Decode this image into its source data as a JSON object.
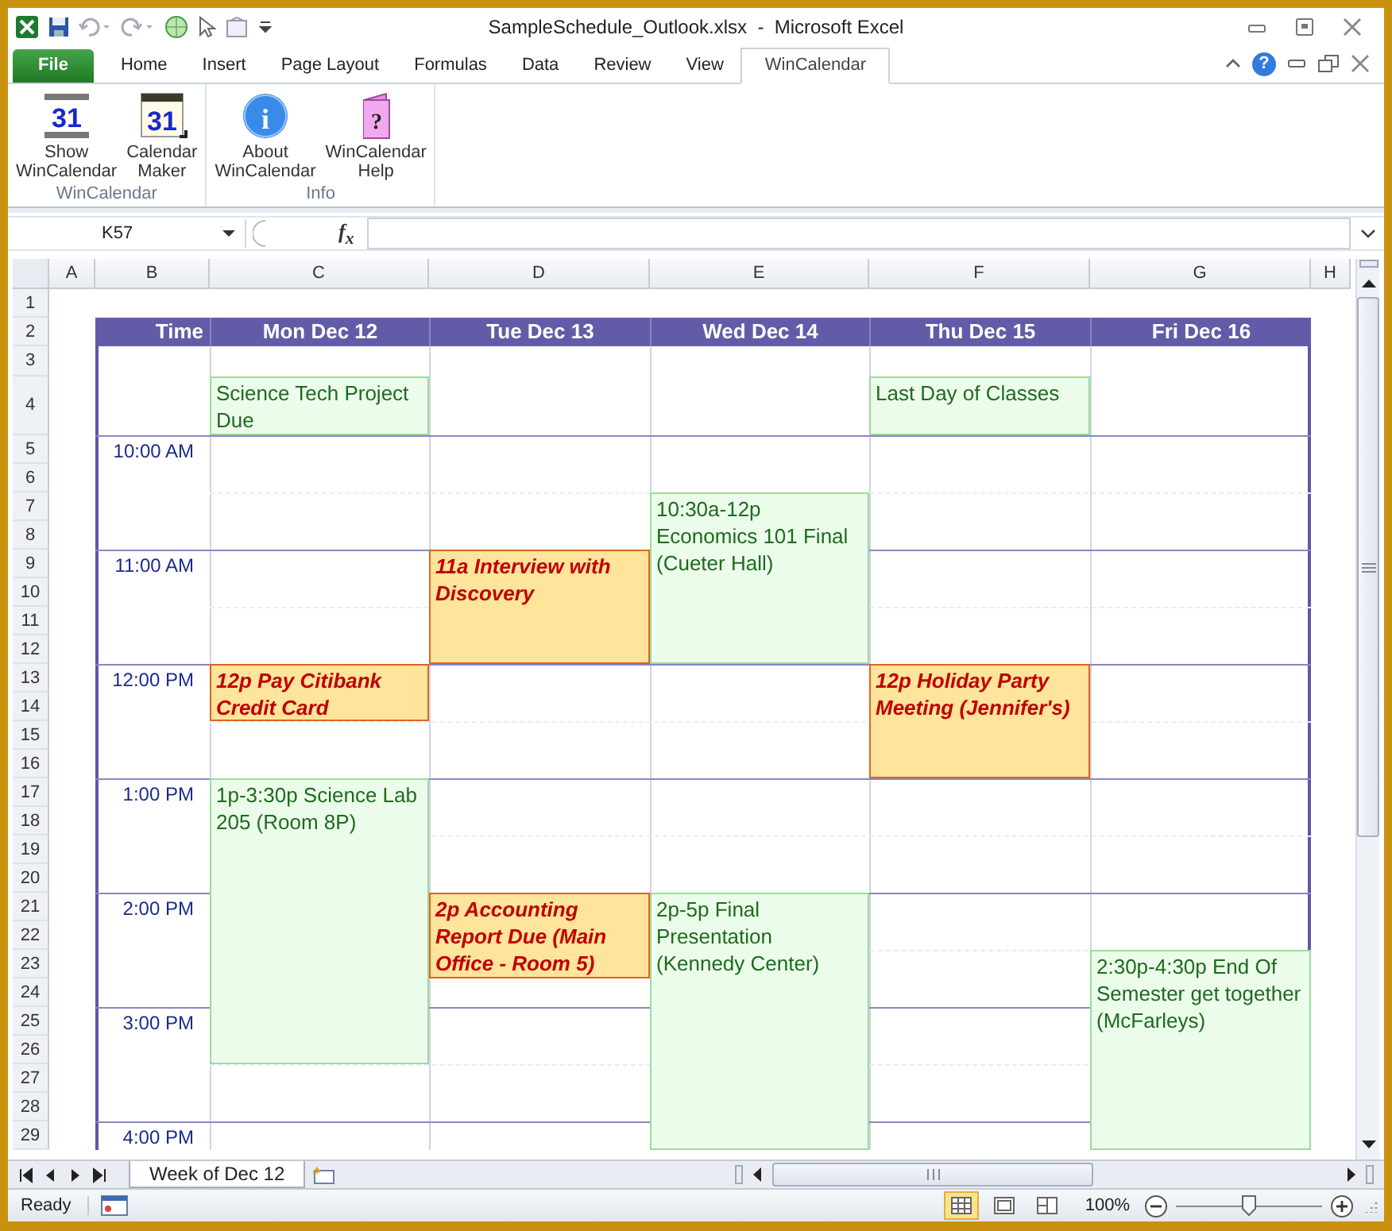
{
  "window": {
    "title": "SampleSchedule_Outlook.xlsx  -  Microsoft Excel"
  },
  "ribbon_tabs": [
    {
      "label": "File",
      "kind": "file",
      "selected": false
    },
    {
      "label": "Home",
      "kind": "tab",
      "selected": false
    },
    {
      "label": "Insert",
      "kind": "tab",
      "selected": false
    },
    {
      "label": "Page Layout",
      "kind": "tab",
      "selected": false
    },
    {
      "label": "Formulas",
      "kind": "tab",
      "selected": false
    },
    {
      "label": "Data",
      "kind": "tab",
      "selected": false
    },
    {
      "label": "Review",
      "kind": "tab",
      "selected": false
    },
    {
      "label": "View",
      "kind": "tab",
      "selected": false
    },
    {
      "label": "WinCalendar",
      "kind": "tab",
      "selected": true
    }
  ],
  "help_glyph": "?",
  "ribbon_groups": [
    {
      "label": "WinCalendar",
      "buttons": [
        {
          "label": "Show WinCalendar",
          "kind": "calendar-arrows",
          "glyph": "31"
        },
        {
          "label": "Calendar Maker",
          "kind": "calendar",
          "glyph": "31"
        }
      ]
    },
    {
      "label": "Info",
      "buttons": [
        {
          "label": "About WinCalendar",
          "kind": "info",
          "glyph": "i"
        },
        {
          "label": "WinCalendar Help",
          "kind": "help-book",
          "glyph": "?"
        }
      ]
    }
  ],
  "formula_bar": {
    "name_box": "K57",
    "function_label": "f$_{x}$"
  },
  "sheet": {
    "columns": [
      "A",
      "B",
      "C",
      "D",
      "E",
      "F",
      "G",
      "H"
    ],
    "rows": [
      {
        "number": "1"
      },
      {
        "number": "2",
        "header": [
          "Time",
          "Mon Dec 12",
          "Tue Dec 13",
          "Wed Dec 14",
          "Thu Dec 15",
          "Fri Dec 16"
        ]
      },
      {
        "number": "3",
        "cells": [
          {
            "kind": "free"
          },
          {
            "kind": "free"
          },
          {
            "kind": "free"
          },
          {
            "kind": "free"
          },
          {
            "kind": "free"
          }
        ]
      },
      {
        "number": "4",
        "cells": [
          {
            "kind": "normal",
            "text": "Science Tech Project Due"
          },
          {
            "kind": "free"
          },
          {
            "kind": "free"
          },
          {
            "kind": "normal",
            "text": "Last Day of Classes"
          },
          {
            "kind": "free"
          }
        ]
      },
      {
        "number": "5",
        "time": "10:00 AM",
        "cells": [
          {
            "kind": "free"
          },
          {
            "kind": "free"
          },
          {
            "kind": "free"
          },
          {
            "kind": "free"
          },
          {
            "kind": "free"
          }
        ]
      },
      {
        "number": "6",
        "cells": [
          {
            "kind": "free"
          },
          {
            "kind": "free"
          },
          {
            "kind": "free"
          },
          {
            "kind": "free"
          },
          {
            "kind": "free"
          }
        ]
      },
      {
        "number": "7",
        "cells": [
          {
            "kind": "free"
          },
          {
            "kind": "free"
          },
          {
            "kind": "normal",
            "text": "10:30a-12p Economics 101 Final (Cueter Hall)"
          },
          {
            "kind": "free"
          },
          {
            "kind": "free"
          }
        ]
      },
      {
        "number": "8",
        "cells": [
          {
            "kind": "free"
          },
          {
            "kind": "free"
          },
          {
            "kind": "continued"
          },
          {
            "kind": "free"
          },
          {
            "kind": "free"
          }
        ]
      },
      {
        "number": "9",
        "time": "11:00 AM",
        "cells": [
          {
            "kind": "free"
          },
          {
            "kind": "important",
            "text": "11a Interview with Discovery"
          },
          {
            "kind": "continued"
          },
          {
            "kind": "free"
          },
          {
            "kind": "free"
          }
        ]
      },
      {
        "number": "10",
        "cells": [
          {
            "kind": "free"
          },
          {
            "kind": "continued"
          },
          {
            "kind": "continued"
          },
          {
            "kind": "free"
          },
          {
            "kind": "free"
          }
        ]
      },
      {
        "number": "11",
        "cells": [
          {
            "kind": "free"
          },
          {
            "kind": "continued"
          },
          {
            "kind": "continued"
          },
          {
            "kind": "free"
          },
          {
            "kind": "free"
          }
        ]
      },
      {
        "number": "12",
        "cells": [
          {
            "kind": "free"
          },
          {
            "kind": "continued"
          },
          {
            "kind": "continued"
          },
          {
            "kind": "free"
          },
          {
            "kind": "free"
          }
        ]
      },
      {
        "number": "13",
        "time": "12:00 PM",
        "cells": [
          {
            "kind": "important",
            "text": "12p Pay Citibank Credit Card"
          },
          {
            "kind": "free"
          },
          {
            "kind": "free"
          },
          {
            "kind": "important",
            "text": "12p Holiday Party Meeting (Jennifer's)"
          },
          {
            "kind": "free"
          }
        ]
      },
      {
        "number": "14",
        "cells": [
          {
            "kind": "continued"
          },
          {
            "kind": "free"
          },
          {
            "kind": "free"
          },
          {
            "kind": "continued"
          },
          {
            "kind": "free"
          }
        ]
      },
      {
        "number": "15",
        "cells": [
          {
            "kind": "free"
          },
          {
            "kind": "free"
          },
          {
            "kind": "free"
          },
          {
            "kind": "continued"
          },
          {
            "kind": "free"
          }
        ]
      },
      {
        "number": "16",
        "cells": [
          {
            "kind": "free"
          },
          {
            "kind": "free"
          },
          {
            "kind": "free"
          },
          {
            "kind": "continued"
          },
          {
            "kind": "free"
          }
        ]
      },
      {
        "number": "17",
        "time": "1:00 PM",
        "cells": [
          {
            "kind": "normal",
            "text": "1p-3:30p Science Lab 205 (Room 8P)"
          },
          {
            "kind": "free"
          },
          {
            "kind": "free"
          },
          {
            "kind": "free"
          },
          {
            "kind": "free"
          }
        ]
      },
      {
        "number": "18",
        "cells": [
          {
            "kind": "continued"
          },
          {
            "kind": "free"
          },
          {
            "kind": "free"
          },
          {
            "kind": "free"
          },
          {
            "kind": "free"
          }
        ]
      },
      {
        "number": "19",
        "cells": [
          {
            "kind": "continued"
          },
          {
            "kind": "free"
          },
          {
            "kind": "free"
          },
          {
            "kind": "free"
          },
          {
            "kind": "free"
          }
        ]
      },
      {
        "number": "20",
        "cells": [
          {
            "kind": "continued"
          },
          {
            "kind": "free"
          },
          {
            "kind": "free"
          },
          {
            "kind": "free"
          },
          {
            "kind": "free"
          }
        ]
      },
      {
        "number": "21",
        "time": "2:00 PM",
        "cells": [
          {
            "kind": "continued"
          },
          {
            "kind": "important",
            "text": "2p Accounting Report Due (Main Office - Room 5)"
          },
          {
            "kind": "normal",
            "text": "2p-5p Final Presentation (Kennedy Center)"
          },
          {
            "kind": "free"
          },
          {
            "kind": "free"
          }
        ]
      },
      {
        "number": "22",
        "cells": [
          {
            "kind": "continued"
          },
          {
            "kind": "continued"
          },
          {
            "kind": "continued"
          },
          {
            "kind": "free"
          },
          {
            "kind": "free"
          }
        ]
      },
      {
        "number": "23",
        "cells": [
          {
            "kind": "continued"
          },
          {
            "kind": "continued"
          },
          {
            "kind": "continued"
          },
          {
            "kind": "free"
          },
          {
            "kind": "normal",
            "text": "2:30p-4:30p End Of Semester get together (McFarleys)"
          }
        ]
      },
      {
        "number": "24",
        "cells": [
          {
            "kind": "continued"
          },
          {
            "kind": "free"
          },
          {
            "kind": "continued"
          },
          {
            "kind": "free"
          },
          {
            "kind": "continued"
          }
        ]
      },
      {
        "number": "25",
        "time": "3:00 PM",
        "cells": [
          {
            "kind": "continued"
          },
          {
            "kind": "free"
          },
          {
            "kind": "continued"
          },
          {
            "kind": "free"
          },
          {
            "kind": "continued"
          }
        ]
      },
      {
        "number": "26",
        "cells": [
          {
            "kind": "continued"
          },
          {
            "kind": "free"
          },
          {
            "kind": "continued"
          },
          {
            "kind": "free"
          },
          {
            "kind": "continued"
          }
        ]
      },
      {
        "number": "27",
        "cells": [
          {
            "kind": "free"
          },
          {
            "kind": "free"
          },
          {
            "kind": "continued"
          },
          {
            "kind": "free"
          },
          {
            "kind": "continued"
          }
        ]
      },
      {
        "number": "28",
        "cells": [
          {
            "kind": "free"
          },
          {
            "kind": "free"
          },
          {
            "kind": "continued"
          },
          {
            "kind": "free"
          },
          {
            "kind": "continued"
          }
        ]
      },
      {
        "number": "29",
        "time": "4:00 PM",
        "cells": [
          {
            "kind": "free"
          },
          {
            "kind": "free"
          },
          {
            "kind": "continued"
          },
          {
            "kind": "free"
          },
          {
            "kind": "continued"
          }
        ]
      }
    ]
  },
  "sheet_tabs": [
    {
      "label": "Week of Dec 12",
      "selected": true
    }
  ],
  "status_bar": {
    "status": "Ready",
    "zoom": "100%",
    "zoom_slider": {
      "level": 0.5
    },
    "views": [
      {
        "kind": "normal",
        "selected": true
      },
      {
        "kind": "page-layout",
        "selected": false
      },
      {
        "kind": "page-break",
        "selected": false
      }
    ]
  }
}
